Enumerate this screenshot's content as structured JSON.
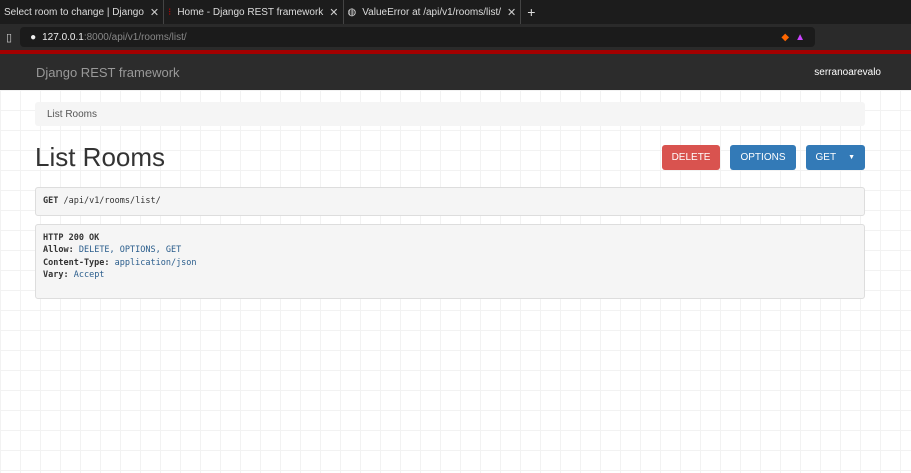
{
  "browser": {
    "tabs": [
      {
        "title": "Select room to change | Django"
      },
      {
        "title": "Home - Django REST framework"
      },
      {
        "title": "ValueError at /api/v1/rooms/list/"
      }
    ],
    "url_host": "127.0.0.1",
    "url_rest": ":8000/api/v1/rooms/list/"
  },
  "navbar": {
    "brand": "Django REST framework",
    "user": "serranoarevalo"
  },
  "breadcrumb": "List Rooms",
  "page": {
    "title": "List Rooms",
    "delete": "DELETE",
    "options": "OPTIONS",
    "get": "GET"
  },
  "request": {
    "method": "GET",
    "path": "/api/v1/rooms/list/"
  },
  "response": {
    "status": "HTTP 200 OK",
    "headers": [
      {
        "k": "Allow:",
        "v": "DELETE, OPTIONS, GET"
      },
      {
        "k": "Content-Type:",
        "v": "application/json"
      },
      {
        "k": "Vary:",
        "v": "Accept"
      }
    ]
  }
}
